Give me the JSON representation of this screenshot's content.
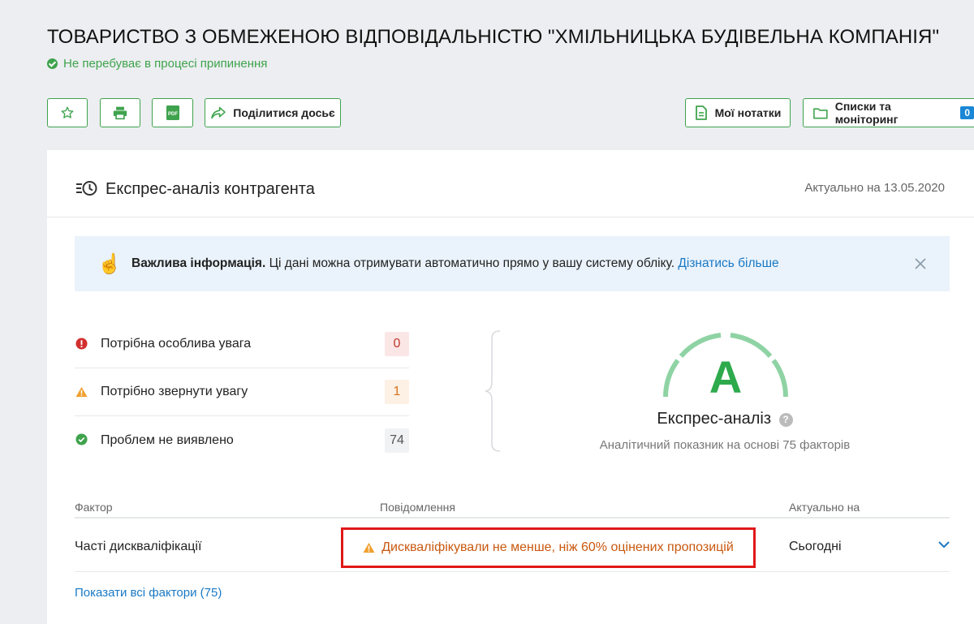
{
  "company": {
    "title": "ТОВАРИСТВО З ОБМЕЖЕНОЮ ВІДПОВІДАЛЬНІСТЮ \"ХМІЛЬНИЦЬКА БУДІВЕЛЬНА КОМПАНІЯ\"",
    "status": "Не перебуває в процесі припинення"
  },
  "toolbar": {
    "share_label": "Поділитися досьє",
    "notes_label": "Мої нотатки",
    "lists_label": "Списки та моніторинг",
    "lists_count": "0",
    "pdf_icon_text": "PDF"
  },
  "analysis": {
    "title": "Експрес-аналіз контрагента",
    "actual_date": "Актуально на 13.05.2020",
    "info": {
      "bold": "Важлива інформація.",
      "text": " Ці дані можна отримувати автоматично прямо у вашу систему обліку. ",
      "link": "Дізнатись більше"
    },
    "counters": [
      {
        "label": "Потрібна особлива увага",
        "value": "0"
      },
      {
        "label": "Потрібно звернути увагу",
        "value": "1"
      },
      {
        "label": "Проблем не виявлено",
        "value": "74"
      }
    ],
    "grade": "A",
    "gauge_title": "Експрес-аналіз",
    "gauge_help": "?",
    "gauge_subtitle": "Аналітичний показник на основі 75 факторів"
  },
  "table": {
    "headers": {
      "factor": "Фактор",
      "message": "Повідомлення",
      "date": "Актуально на"
    },
    "rows": [
      {
        "factor": "Часті дискваліфікації",
        "message": "Дискваліфікували не менше, ніж 60% оцінених пропозицій",
        "date": "Сьогодні"
      }
    ],
    "show_all": "Показати всі фактори (75)"
  },
  "colors": {
    "accent_green": "#3fa34d",
    "link_blue": "#1a79c4",
    "warning_orange": "#c9580f",
    "highlight_red": "#e01818"
  }
}
